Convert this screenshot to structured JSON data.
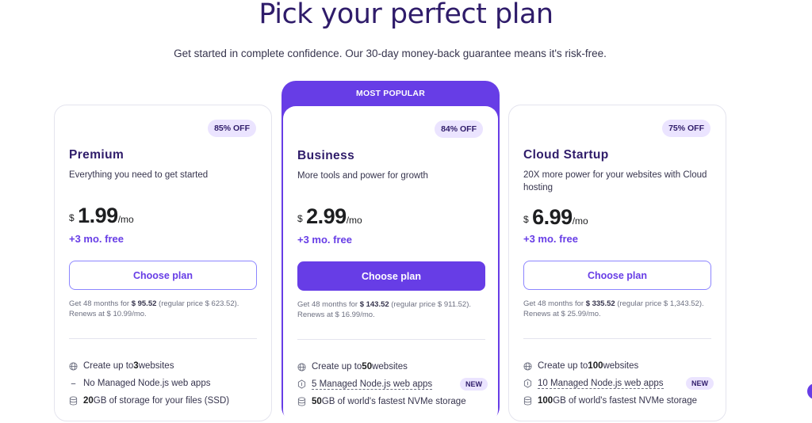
{
  "hero": {
    "title": "Pick your perfect plan",
    "subtitle": "Get started in complete confidence. Our 30-day money-back guarantee means it's risk-free."
  },
  "colors": {
    "accent": "#673de6",
    "badge_bg": "#ebe4ff",
    "heading": "#2f1c6a"
  },
  "plans": [
    {
      "badge": "85% OFF",
      "name": "Premium",
      "desc": "Everything you need to get started",
      "currency": "$",
      "price": "1.99",
      "per": "/mo",
      "free": "+3 mo. free",
      "button": "Choose plan",
      "renew": {
        "a": "Get 48 months for ",
        "b": "$ 95.52",
        "c": " (regular price $ 623.52). Renews at $ 10.99/mo."
      },
      "features": [
        {
          "pre": "Create up to ",
          "bold": "3",
          "post": " websites",
          "icon": "globe-icon"
        },
        {
          "pre": "No Managed Node.js web apps",
          "bold": "",
          "post": "",
          "icon": "dash-icon"
        },
        {
          "pre": "",
          "bold": "20",
          "post": " GB of storage for your files (SSD)",
          "icon": "storage-icon"
        }
      ]
    },
    {
      "popular": "MOST POPULAR",
      "badge": "84% OFF",
      "name": "Business",
      "desc": "More tools and power for growth",
      "currency": "$",
      "price": "2.99",
      "per": "/mo",
      "free": "+3 mo. free",
      "button": "Choose plan",
      "renew": {
        "a": "Get 48 months for ",
        "b": "$ 143.52",
        "c": " (regular price $ 911.52). Renews at $ 16.99/mo."
      },
      "features": [
        {
          "pre": "Create up to ",
          "bold": "50",
          "post": " websites",
          "icon": "globe-icon"
        },
        {
          "pre": "5 Managed Node.js web apps",
          "bold": "",
          "post": "",
          "icon": "nodejs-icon",
          "new": "NEW"
        },
        {
          "pre": "",
          "bold": "50",
          "post": " GB of world's fastest NVMe storage",
          "icon": "storage-icon"
        }
      ]
    },
    {
      "badge": "75% OFF",
      "name": "Cloud Startup",
      "desc": "20X more power for your websites with Cloud hosting",
      "currency": "$",
      "price": "6.99",
      "per": "/mo",
      "free": "+3 mo. free",
      "button": "Choose plan",
      "renew": {
        "a": "Get 48 months for ",
        "b": "$ 335.52",
        "c": " (regular price $ 1,343.52). Renews at $ 25.99/mo."
      },
      "features": [
        {
          "pre": "Create up to ",
          "bold": "100",
          "post": " websites",
          "icon": "globe-icon"
        },
        {
          "pre": "10 Managed Node.js web apps",
          "bold": "",
          "post": "",
          "icon": "nodejs-icon",
          "new": "NEW"
        },
        {
          "pre": "",
          "bold": "100",
          "post": " GB of world's fastest NVMe storage",
          "icon": "storage-icon"
        }
      ]
    }
  ]
}
